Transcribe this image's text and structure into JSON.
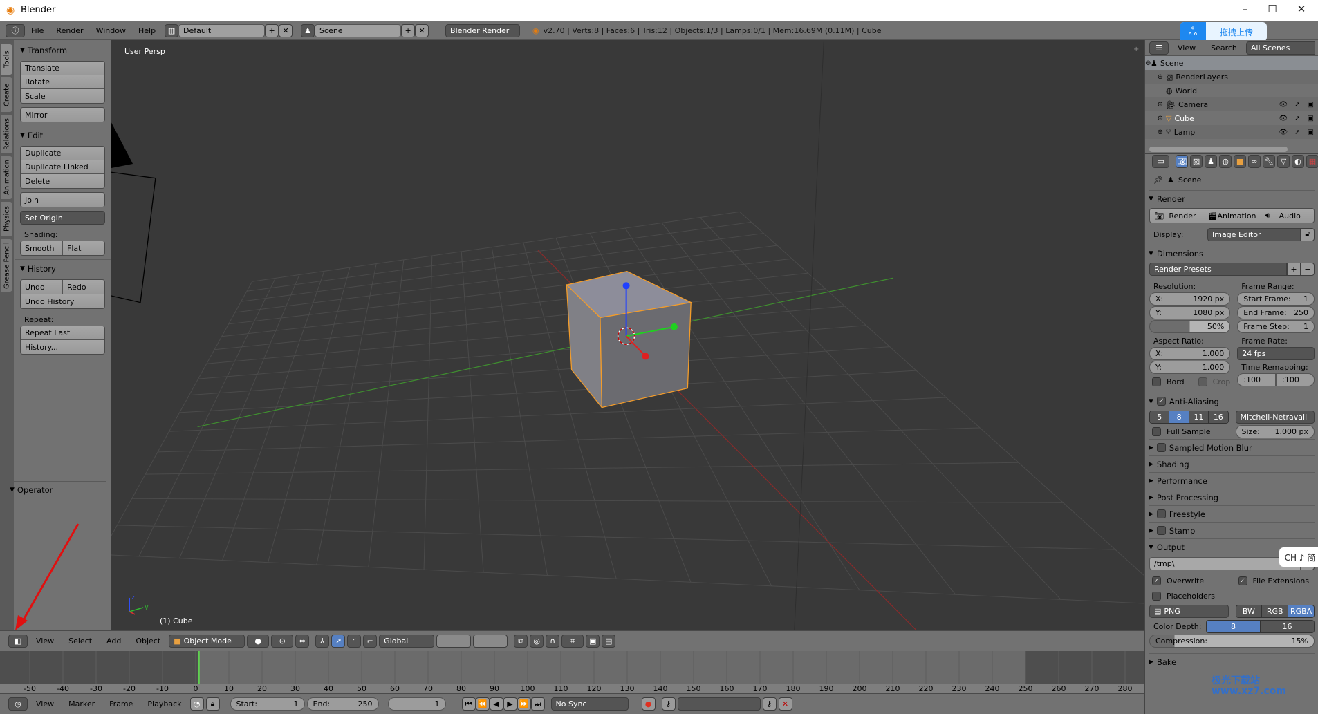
{
  "window": {
    "title": "Blender",
    "minimize": "–",
    "maximize": "☐",
    "close": "✕"
  },
  "info_header": {
    "menus": [
      "File",
      "Render",
      "Window",
      "Help"
    ],
    "layout": "Default",
    "scene": "Scene",
    "engine": "Blender Render",
    "stats": "v2.70 | Verts:8 | Faces:6 | Tris:12 | Objects:1/3 | Lamps:0/1 | Mem:16.69M (0.11M) | Cube"
  },
  "overlay": {
    "upload_label": "拖拽上传",
    "ime": "CH ♪ 简",
    "watermark": "极光下载站 www.xz7.com"
  },
  "tool_tabs": [
    "Tools",
    "Create",
    "Relations",
    "Animation",
    "Physics",
    "Grease Pencil"
  ],
  "tool_shelf": {
    "transform": {
      "title": "Transform",
      "buttons": [
        "Translate",
        "Rotate",
        "Scale"
      ],
      "mirror": "Mirror"
    },
    "edit": {
      "title": "Edit",
      "buttons": [
        "Duplicate",
        "Duplicate Linked",
        "Delete"
      ],
      "join": "Join",
      "set_origin": "Set Origin",
      "shading_label": "Shading:",
      "smooth": "Smooth",
      "flat": "Flat"
    },
    "history": {
      "title": "History",
      "undo": "Undo",
      "redo": "Redo",
      "undo_history": "Undo History",
      "repeat_label": "Repeat:",
      "repeat_last": "Repeat Last",
      "history": "History..."
    },
    "operator": {
      "title": "Operator"
    }
  },
  "viewport": {
    "view_label": "User Persp",
    "object_label": "(1) Cube",
    "axis_x": "x",
    "axis_y": "y",
    "axis_z": "z",
    "colors": {
      "x_axis": "#8b2a2a",
      "y_axis": "#3f8f2f",
      "selection": "#f39c2a"
    }
  },
  "header_3d": {
    "menus": [
      "View",
      "Select",
      "Add",
      "Object"
    ],
    "mode": "Object Mode",
    "orientation": "Global"
  },
  "timeline": {
    "ticks": [
      -50,
      -40,
      -30,
      -20,
      -10,
      0,
      10,
      20,
      30,
      40,
      50,
      60,
      70,
      80,
      90,
      100,
      110,
      120,
      130,
      140,
      150,
      160,
      170,
      180,
      190,
      200,
      210,
      220,
      230,
      240,
      250,
      260,
      270,
      280
    ],
    "current_frame": 1,
    "start": 1,
    "end": 250,
    "header": {
      "menus": [
        "View",
        "Marker",
        "Frame",
        "Playback"
      ],
      "start_label": "Start:",
      "start_value": "1",
      "end_label": "End:",
      "end_value": "250",
      "current_value": "1",
      "sync": "No Sync"
    }
  },
  "outliner": {
    "menus": [
      "View",
      "Search"
    ],
    "filter": "All Scenes",
    "items": [
      {
        "label": "Scene",
        "icon": "scene-icon"
      },
      {
        "label": "RenderLayers",
        "icon": "render-layers-icon"
      },
      {
        "label": "World",
        "icon": "world-icon"
      },
      {
        "label": "Camera",
        "icon": "camera-icon"
      },
      {
        "label": "Cube",
        "icon": "mesh-icon"
      },
      {
        "label": "Lamp",
        "icon": "lamp-icon"
      }
    ]
  },
  "properties": {
    "context": "Scene",
    "render": {
      "title": "Render",
      "render_btn": "Render",
      "animation_btn": "Animation",
      "audio_btn": "Audio",
      "display_label": "Display:",
      "display_value": "Image Editor"
    },
    "dimensions": {
      "title": "Dimensions",
      "presets": "Render Presets",
      "resolution_label": "Resolution:",
      "res_x_label": "X:",
      "res_x": "1920 px",
      "res_y_label": "Y:",
      "res_y": "1080 px",
      "res_pct": "50%",
      "res_pct_value": 50,
      "frame_range_label": "Frame Range:",
      "start_label": "Start Frame:",
      "start": "1",
      "end_label": "End Frame:",
      "end": "250",
      "step_label": "Frame Step:",
      "step": "1",
      "aspect_label": "Aspect Ratio:",
      "asp_x_label": "X:",
      "asp_x": "1.000",
      "asp_y_label": "Y:",
      "asp_y": "1.000",
      "frame_rate_label": "Frame Rate:",
      "frame_rate": "24 fps",
      "remap_label": "Time Remapping:",
      "remap_old": ":100",
      "remap_new": ":100",
      "bord": "Bord",
      "crop": "Crop"
    },
    "anti_aliasing": {
      "title": "Anti-Aliasing",
      "enabled": true,
      "samples": [
        "5",
        "8",
        "11",
        "16"
      ],
      "selected": "8",
      "filter": "Mitchell-Netravali",
      "full_sample": "Full Sample",
      "size_label": "Size:",
      "size": "1.000 px"
    },
    "collapsed": [
      "Sampled Motion Blur",
      "Shading",
      "Performance",
      "Post Processing",
      "Freestyle",
      "Stamp"
    ],
    "output": {
      "title": "Output",
      "path": "/tmp\\",
      "overwrite": "Overwrite",
      "file_ext": "File Extensions",
      "placeholders": "Placeholders",
      "format": "PNG",
      "modes": [
        "BW",
        "RGB",
        "RGBA"
      ],
      "mode_selected": "RGBA",
      "depth_label": "Color Depth:",
      "depths": [
        "8",
        "16"
      ],
      "depth_selected": "8",
      "compression_label": "Compression:",
      "compression": "15%",
      "compression_value": 15
    },
    "bake": {
      "title": "Bake"
    }
  }
}
